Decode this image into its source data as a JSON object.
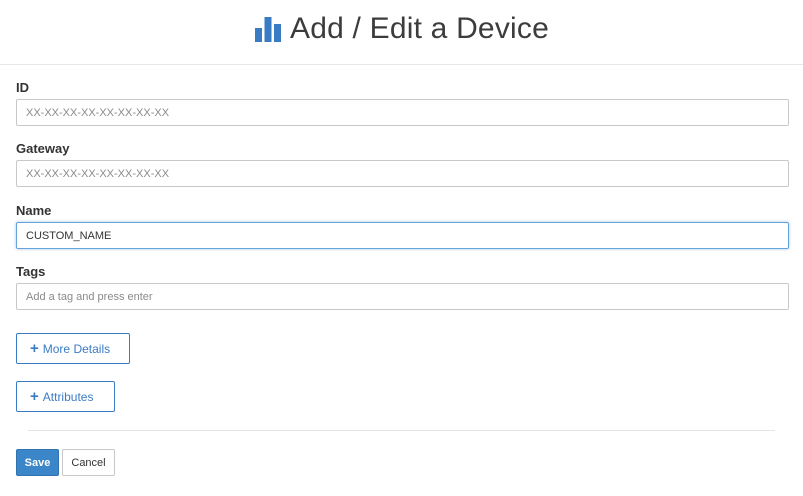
{
  "header": {
    "title": "Add / Edit a Device",
    "icon": "bar-chart-icon",
    "icon_color": "#3a7cc4"
  },
  "form": {
    "id": {
      "label": "ID",
      "value": "",
      "placeholder": "XX-XX-XX-XX-XX-XX-XX-XX"
    },
    "gateway": {
      "label": "Gateway",
      "value": "",
      "placeholder": "XX-XX-XX-XX-XX-XX-XX-XX"
    },
    "name": {
      "label": "Name",
      "value": "CUSTOM_NAME",
      "placeholder": ""
    },
    "tags": {
      "label": "Tags",
      "value": "",
      "placeholder": "Add a tag and press enter"
    }
  },
  "buttons": {
    "more_details": "More Details",
    "attributes": "Attributes",
    "save": "Save",
    "cancel": "Cancel"
  },
  "colors": {
    "accent": "#3a7cc4",
    "primary_button": "#3a86c8"
  }
}
